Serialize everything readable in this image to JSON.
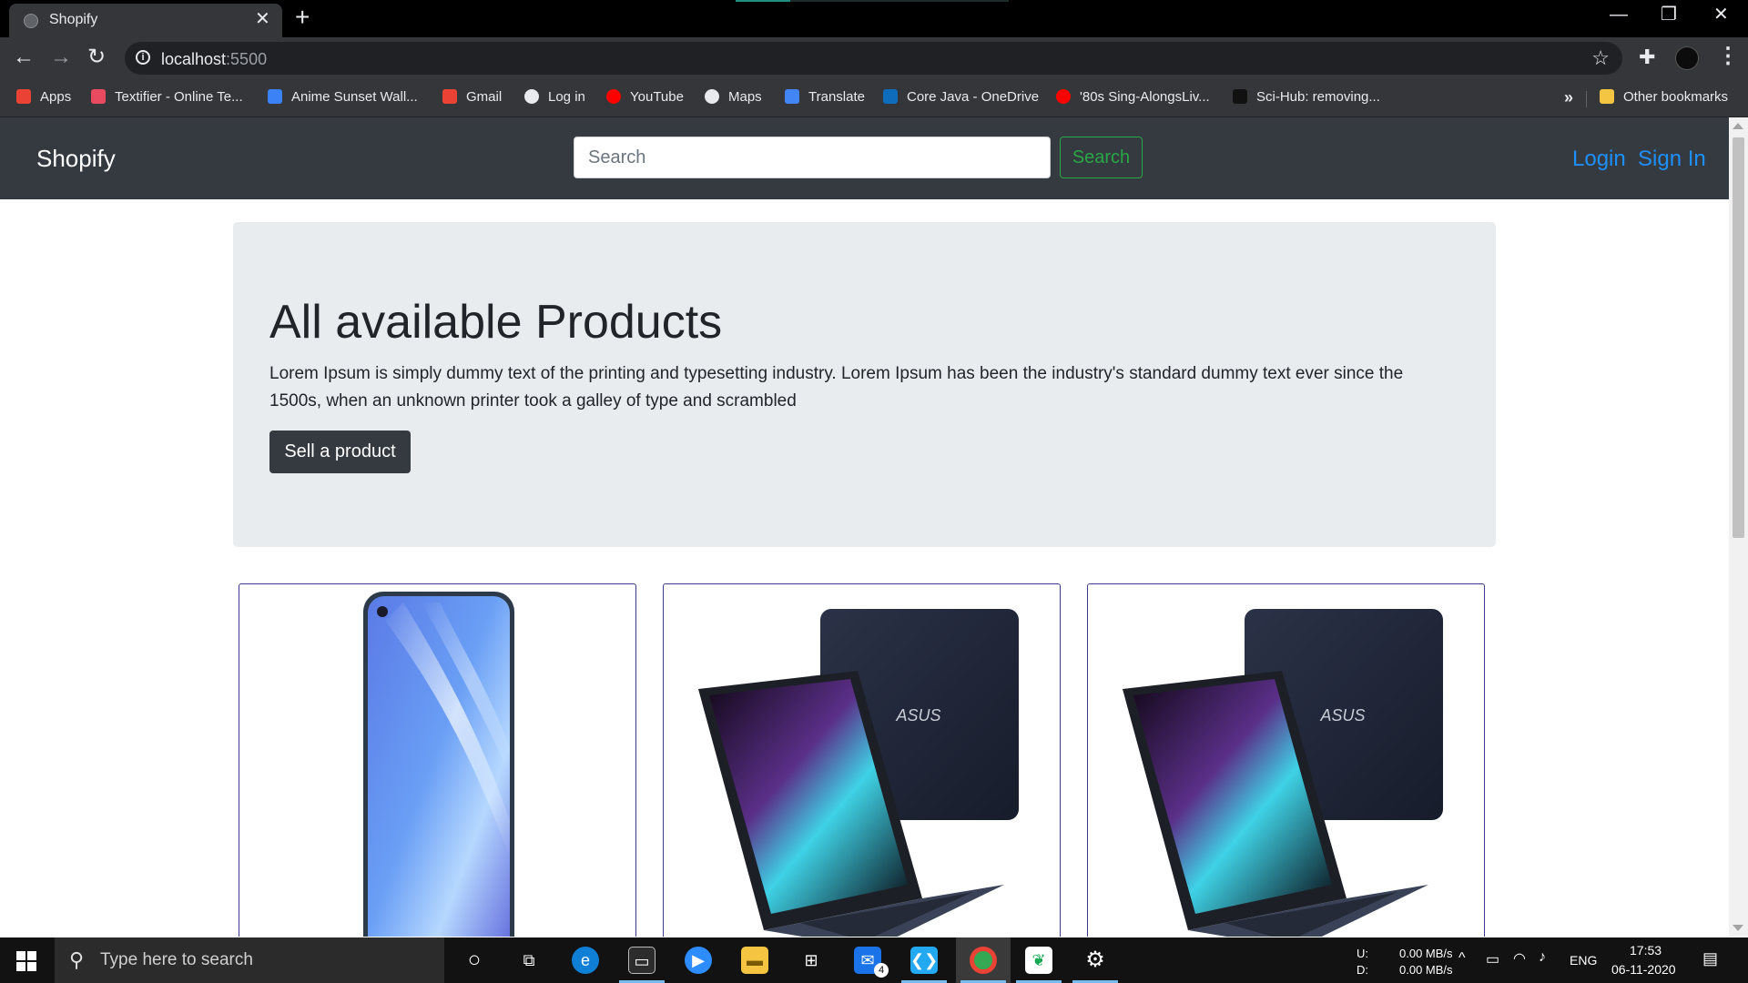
{
  "browser": {
    "tab_title": "Shopify",
    "tab_close": "✕",
    "new_tab": "+",
    "window_controls": {
      "minimize": "—",
      "restore": "❐",
      "close": "✕"
    },
    "address": {
      "host": "localhost",
      "port": ":5500"
    },
    "nav": {
      "back": "←",
      "forward": "→",
      "reload": "↻"
    },
    "bookmarks": [
      {
        "label": "Apps",
        "icon": "apps-grid-icon",
        "color": "#ea4335"
      },
      {
        "label": "Textifier - Online Te...",
        "icon": "textifier-icon",
        "color": "#e84a5f"
      },
      {
        "label": "Anime Sunset Wall...",
        "icon": "wallpaper-icon",
        "color": "#3b82f6"
      },
      {
        "label": "Gmail",
        "icon": "gmail-icon",
        "color": "#ea4335"
      },
      {
        "label": "Log in",
        "icon": "globe-icon",
        "color": "#e8eaed"
      },
      {
        "label": "YouTube",
        "icon": "youtube-icon",
        "color": "#ff0000"
      },
      {
        "label": "Maps",
        "icon": "globe-icon",
        "color": "#e8eaed"
      },
      {
        "label": "Translate",
        "icon": "translate-icon",
        "color": "#4285f4"
      },
      {
        "label": "Core Java - OneDrive",
        "icon": "onedrive-icon",
        "color": "#0f6cbd"
      },
      {
        "label": "'80s Sing-AlongsLiv...",
        "icon": "youtube-icon",
        "color": "#ff0000"
      },
      {
        "label": "Sci-Hub: removing...",
        "icon": "scihub-icon",
        "color": "#111111"
      }
    ],
    "bookmarks_overflow": "»",
    "other_bookmarks": "Other bookmarks"
  },
  "navbar": {
    "brand": "Shopify",
    "search_placeholder": "Search",
    "search_button": "Search",
    "login": "Login",
    "sign_in": "Sign In"
  },
  "hero": {
    "title": "All available Products",
    "text": "Lorem Ipsum is simply dummy text of the printing and typesetting industry. Lorem Ipsum has been the industry's standard dummy text ever since the 1500s, when an unknown printer took a galley of type and scrambled",
    "button": "Sell a product"
  },
  "products": [
    {
      "image": "smartphone-image"
    },
    {
      "image": "asus-laptop-image",
      "logo": "ASUS"
    },
    {
      "image": "asus-laptop-image",
      "logo": "ASUS"
    }
  ],
  "taskbar": {
    "search_placeholder": "Type here to search",
    "mail_badge": "4",
    "network": {
      "up_label": "U:",
      "down_label": "D:",
      "up": "0.00 MB/s",
      "down": "0.00 MB/s"
    },
    "language": "ENG",
    "time": "17:53",
    "date": "06-11-2020"
  }
}
